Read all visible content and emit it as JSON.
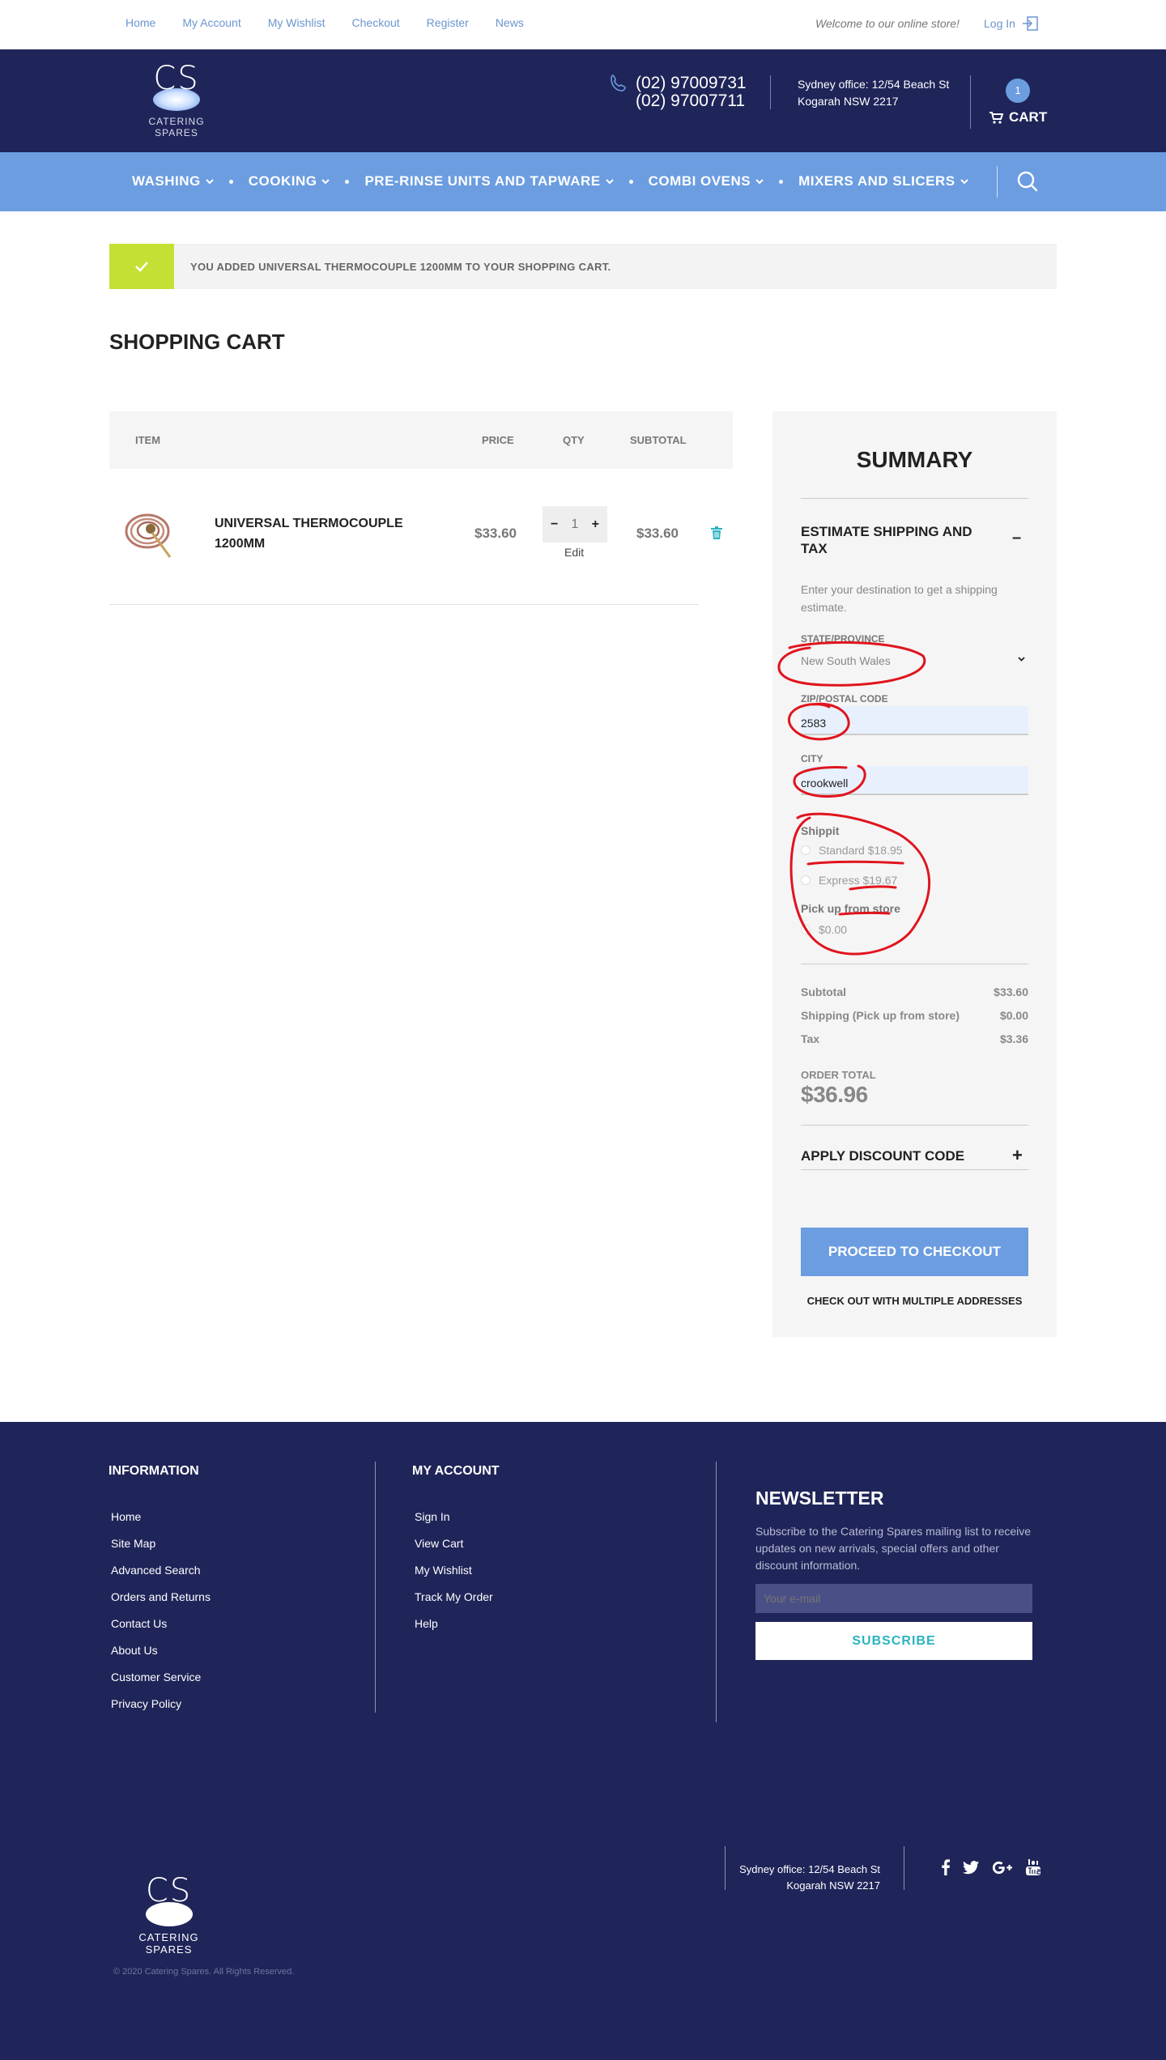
{
  "topbar": {
    "links": [
      "Home",
      "My Account",
      "My Wishlist",
      "Checkout",
      "Register",
      "News"
    ],
    "welcome": "Welcome to our online store!",
    "login": "Log In"
  },
  "header": {
    "logo_letters": "CS",
    "logo_tagline": "CATERING SPARES",
    "phone1": "(02) 97009731",
    "phone2": "(02) 97007711",
    "office_line1": "Sydney office: 12/54 Beach St",
    "office_line2": "Kogarah NSW 2217",
    "cart_count": "1",
    "cart_label": "CART"
  },
  "nav": {
    "items": [
      "WASHING",
      "COOKING",
      "PRE-RINSE UNITS AND TAPWARE",
      "COMBI OVENS",
      "MIXERS AND SLICERS"
    ]
  },
  "message": "YOU ADDED UNIVERSAL THERMOCOUPLE 1200MM TO YOUR SHOPPING CART.",
  "page_title": "SHOPPING CART",
  "cart": {
    "headers": {
      "item": "ITEM",
      "price": "PRICE",
      "qty": "QTY",
      "subtotal": "SUBTOTAL"
    },
    "row": {
      "name": "UNIVERSAL THERMOCOUPLE 1200MM",
      "price": "$33.60",
      "qty": "1",
      "minus": "−",
      "plus": "+",
      "edit": "Edit",
      "subtotal": "$33.60"
    }
  },
  "summary": {
    "title": "SUMMARY",
    "estimate_title": "ESTIMATE SHIPPING AND TAX",
    "estimate_hint": "Enter your destination to get a shipping estimate.",
    "state_label": "STATE/PROVINCE",
    "state_value": "New South Wales",
    "zip_label": "ZIP/POSTAL CODE",
    "zip_value": "2583",
    "city_label": "CITY",
    "city_value": "crookwell",
    "carrier1": "Shippit",
    "opt_standard": "Standard $18.95",
    "opt_express": "Express $19.67",
    "carrier2": "Pick up from store",
    "opt_pickup": "$0.00",
    "subtotal_label": "Subtotal",
    "subtotal_value": "$33.60",
    "shipping_label": "Shipping (Pick up from store)",
    "shipping_value": "$0.00",
    "tax_label": "Tax",
    "tax_value": "$3.36",
    "order_total_label": "ORDER TOTAL",
    "order_total_value": "$36.96",
    "discount_title": "APPLY DISCOUNT CODE",
    "proceed": "PROCEED TO CHECKOUT",
    "multi": "CHECK OUT WITH MULTIPLE ADDRESSES"
  },
  "footer": {
    "info_title": "INFORMATION",
    "info_links": [
      "Home",
      "Site Map",
      "Advanced Search",
      "Orders and Returns",
      "Contact Us",
      "About Us",
      "Customer Service",
      "Privacy Policy"
    ],
    "account_title": "MY ACCOUNT",
    "account_links": [
      "Sign In",
      "View Cart",
      "My Wishlist",
      "Track My Order",
      "Help"
    ],
    "newsletter_title": "NEWSLETTER",
    "newsletter_text": "Subscribe to the Catering Spares mailing list to receive updates on new arrivals, special offers and other discount information.",
    "email_placeholder": "Your e-mail",
    "subscribe": "SUBSCRIBE",
    "logo_letters": "CS",
    "logo_tagline": "CATERING SPARES",
    "copyright": "© 2020 Catering Spares. All Rights Reserved.",
    "office_line1": "Sydney office: 12/54 Beach St",
    "office_line2": "Kogarah NSW 2217",
    "social_icons": [
      "facebook-icon",
      "twitter-icon",
      "google-plus-icon",
      "youtube-icon"
    ]
  },
  "colors": {
    "navy": "#1f2559",
    "nav_blue": "#6b9de0",
    "success_green": "#c5e035",
    "annotation_red": "#e0141e",
    "teal": "#2bb3c0"
  }
}
